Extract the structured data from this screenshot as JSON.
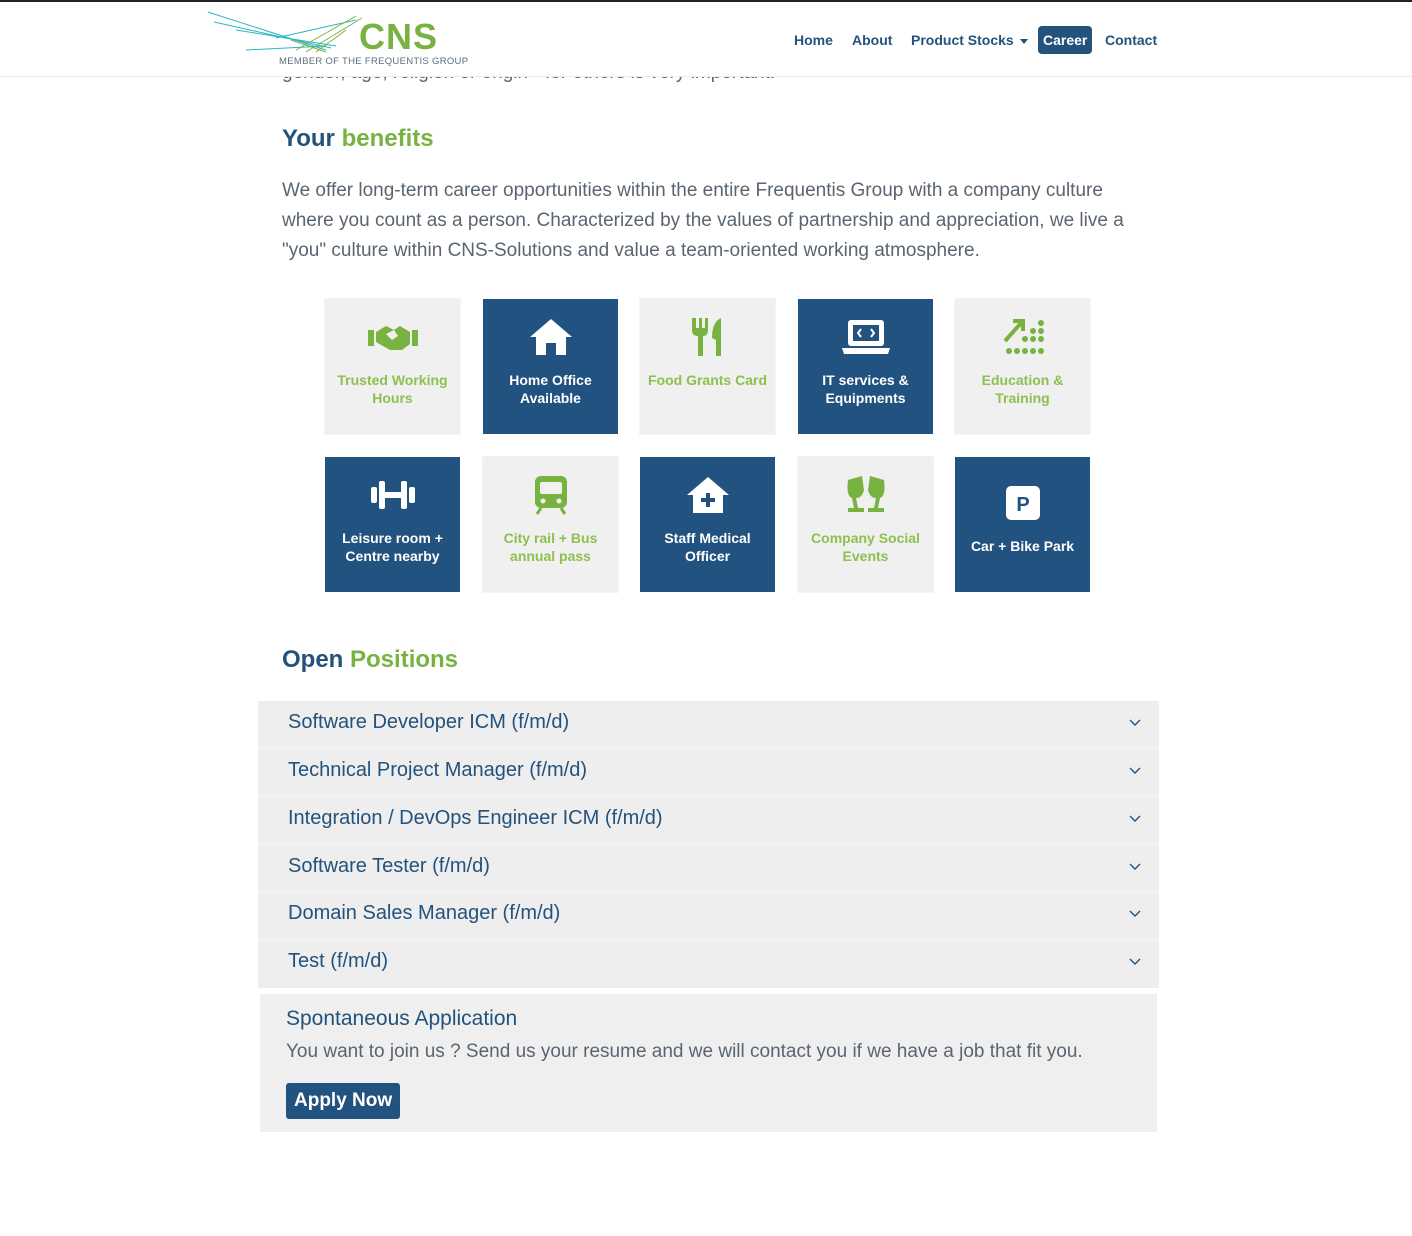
{
  "header": {
    "logo_text": "CNS",
    "logo_subtitle": "MEMBER OF THE FREQUENTIS GROUP",
    "nav": {
      "home": "Home",
      "about": "About",
      "product_stocks": "Product Stocks",
      "career": "Career",
      "contact": "Contact"
    },
    "active_item": "Career"
  },
  "cut_text": "gender, age, religion or origin - for others is very important.",
  "benefits": {
    "title_a": "Your",
    "title_b": "benefits",
    "intro": "We offer long-term career opportunities within the entire Frequentis Group with a company culture where you count as a person. Characterized by the values of partnership and appreciation, we live a \"you\" culture within CNS-Solutions and value a team-oriented working atmosphere.",
    "tiles": [
      {
        "label": "Trusted Working Hours",
        "icon": "handshake-icon",
        "style": "light"
      },
      {
        "label": "Home Office Available",
        "icon": "home-icon",
        "style": "dark"
      },
      {
        "label": "Food Grants Card",
        "icon": "utensils-icon",
        "style": "light"
      },
      {
        "label": "IT services & Equipments",
        "icon": "laptop-code-icon",
        "style": "dark"
      },
      {
        "label": "Education & Training",
        "icon": "growth-chart-icon",
        "style": "light"
      },
      {
        "label": "Leisure room + Centre nearby",
        "icon": "dumbbell-icon",
        "style": "dark"
      },
      {
        "label": "City rail + Bus annual pass",
        "icon": "train-icon",
        "style": "light"
      },
      {
        "label": "Staff Medical Officer",
        "icon": "clinic-icon",
        "style": "dark"
      },
      {
        "label": "Company Social Events",
        "icon": "glass-cheers-icon",
        "style": "light"
      },
      {
        "label": "Car + Bike Park",
        "icon": "parking-icon",
        "style": "dark"
      }
    ]
  },
  "positions": {
    "title_a": "Open",
    "title_b": "Positions",
    "items": [
      "Software Developer ICM (f/m/d)",
      "Technical Project Manager (f/m/d)",
      "Integration / DevOps Engineer ICM (f/m/d)",
      "Software Tester (f/m/d)",
      "Domain Sales Manager (f/m/d)",
      "Test (f/m/d)"
    ]
  },
  "spontaneous": {
    "title": "Spontaneous Application",
    "text": "You want to join us ? Send us your resume and we will contact you if we have a job that fit you.",
    "button": "Apply Now"
  },
  "colors": {
    "brand_blue": "#23527c",
    "brand_green": "#78b241",
    "tile_dark": "#22527f",
    "tile_light": "#f0f0f0"
  }
}
